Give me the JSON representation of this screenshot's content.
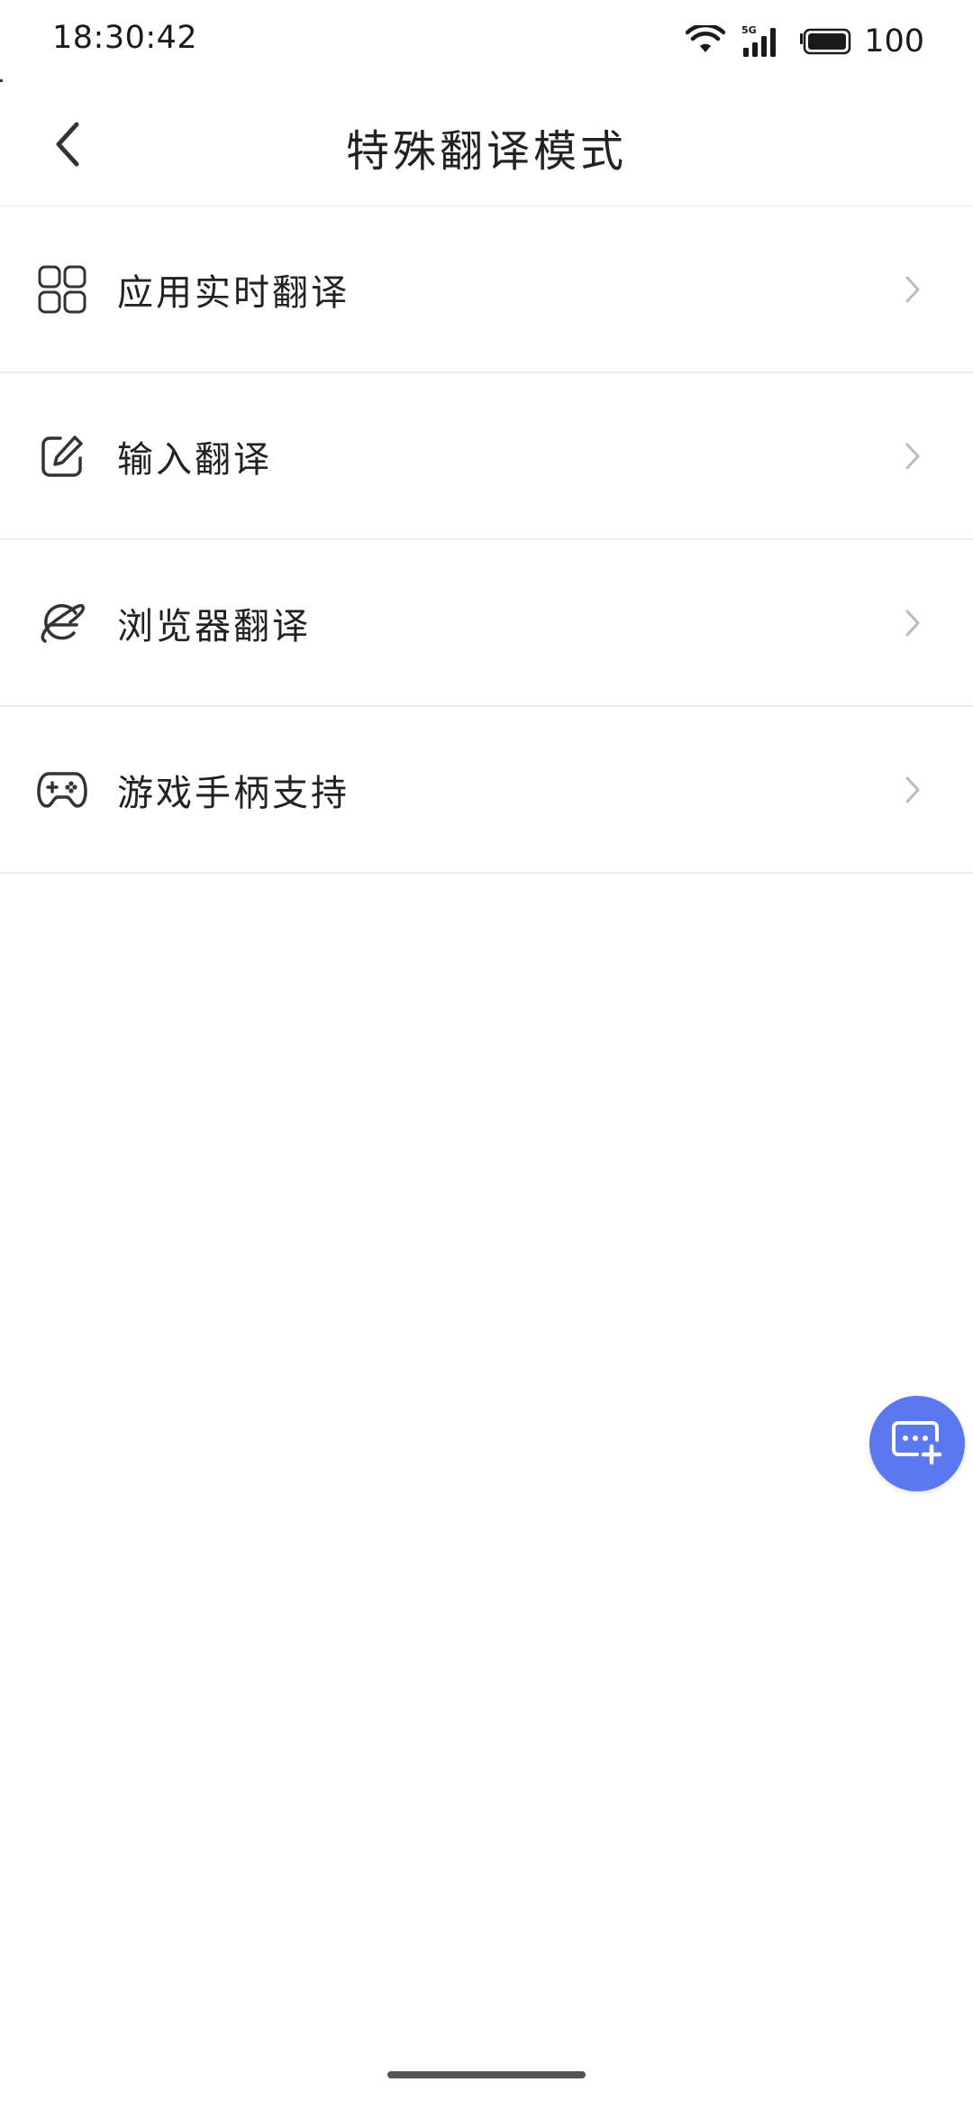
{
  "status_bar": {
    "time": "18:30:42",
    "network_label": "5G",
    "battery_level": "100",
    "icons": [
      "wifi-icon",
      "cellular-signal-icon",
      "battery-icon"
    ]
  },
  "header": {
    "title": "特殊翻译模式",
    "back_icon": "chevron-left-icon"
  },
  "menu": {
    "items": [
      {
        "label": "应用实时翻译",
        "icon": "app-grid-icon"
      },
      {
        "label": "输入翻译",
        "icon": "edit-icon"
      },
      {
        "label": "浏览器翻译",
        "icon": "browser-icon"
      },
      {
        "label": "游戏手柄支持",
        "icon": "gamepad-icon"
      }
    ],
    "chevron_icon": "chevron-right-icon"
  },
  "fab": {
    "icon": "add-translation-icon",
    "color": "#5b78f0"
  },
  "colors": {
    "accent": "#5b78f0",
    "divider": "#ececec",
    "text": "#222222",
    "chevron": "#bbbbbb"
  }
}
